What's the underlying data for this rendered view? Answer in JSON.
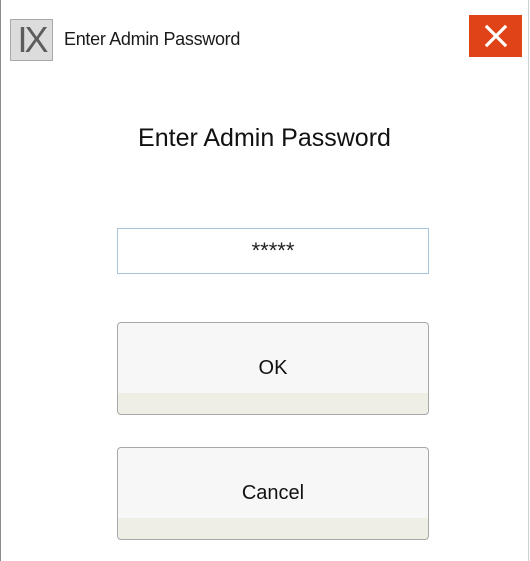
{
  "window": {
    "title": "Enter Admin Password",
    "app_icon_text": "IX",
    "close_icon": "close-icon",
    "close_color": "#e04318"
  },
  "dialog": {
    "heading": "Enter Admin Password",
    "password_value": "*****",
    "ok_label": "OK",
    "cancel_label": "Cancel"
  }
}
